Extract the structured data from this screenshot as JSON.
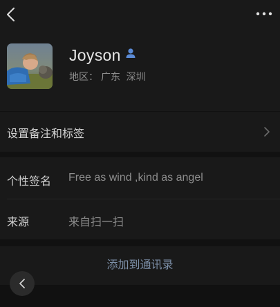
{
  "contact": {
    "name": "Joyson",
    "region_label": "地区：",
    "region_province": "广东",
    "region_city": "深圳"
  },
  "rows": {
    "remark_tags_label": "设置备注和标签",
    "signature_label": "个性签名",
    "signature_value": "Free as wind ,kind as angel",
    "source_label": "来源",
    "source_value": "来自扫一扫"
  },
  "actions": {
    "add_contact_label": "添加到通讯录"
  },
  "icons": {
    "back": "back-icon",
    "more": "more-icon",
    "gender": "male-icon",
    "chevron": "chevron-right-icon"
  },
  "colors": {
    "background": "#191919",
    "separator": "#111111",
    "link": "#7d90a9",
    "gender_male": "#5b8bd6"
  }
}
